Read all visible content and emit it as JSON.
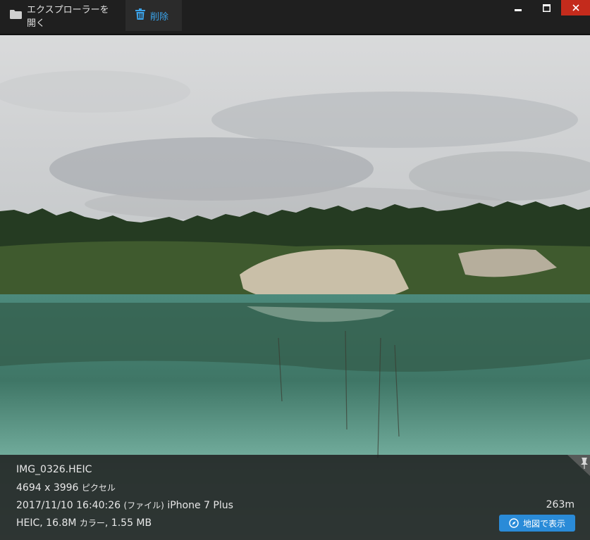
{
  "toolbar": {
    "open_explorer_label": "エクスプローラーを開く",
    "delete_label": "削除"
  },
  "window": {
    "minimize_symbol": "▬",
    "maximize_symbol": "□",
    "close_symbol": "✕"
  },
  "info": {
    "filename": "IMG_0326.HEIC",
    "dimensions": "4694 x 3996",
    "dimensions_unit": "ピクセル",
    "datetime": "2017/11/10 16:40:26",
    "datetime_source": "(ファイル)",
    "camera": "iPhone 7 Plus",
    "format": "HEIC, 16.8M",
    "color_label": "カラー",
    "size": ", 1.55 MB",
    "distance": "263m",
    "map_button_label": "地図で表示"
  },
  "colors": {
    "accent": "#3ba3ea",
    "map_button": "#2a8bd8",
    "close_button": "#c42b1c"
  },
  "icons": {
    "open_explorer": "folder-icon",
    "delete": "trash-icon",
    "map": "compass-icon",
    "pin": "pin-icon"
  }
}
